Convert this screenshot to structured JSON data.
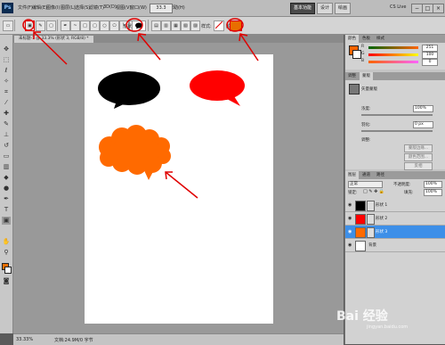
{
  "app": {
    "logo": "Ps",
    "menus": [
      "文件(F)",
      "编辑(E)",
      "图像(I)",
      "图层(L)",
      "选择(S)",
      "滤镜(T)",
      "3D(D)",
      "视图(V)",
      "窗口(W)",
      "帮助(H)"
    ],
    "zoom_label": "33.3",
    "workspaces": [
      "基本功能",
      "设计",
      "绘画"
    ],
    "cs_live": "CS Live",
    "window_controls": [
      "−",
      "□",
      "×"
    ]
  },
  "options_bar": {
    "style_label": "样式:",
    "color_label": "颜色:",
    "shape_label": "形状:",
    "color_value": "#e86e00"
  },
  "document": {
    "tab_label": "未标题-1 @ 33.3% (形状 3, RGB/8) *"
  },
  "shapes": [
    {
      "name": "black-speech-bubble",
      "color": "#000000"
    },
    {
      "name": "red-speech-bubble",
      "color": "#ff0000"
    },
    {
      "name": "orange-thought-bubble",
      "color": "#ff6a00"
    }
  ],
  "status": {
    "zoom": "33.33%",
    "doc": "文档:24.9M/0 字节"
  },
  "color_panel": {
    "tabs": [
      "颜色",
      "色板",
      "样式"
    ],
    "channels": [
      {
        "label": "R",
        "value": "251"
      },
      {
        "label": "G",
        "value": "100"
      },
      {
        "label": "B",
        "value": "0"
      }
    ]
  },
  "adjust_panel": {
    "tabs": [
      "调整",
      "蒙版"
    ],
    "title": "矢量蒙版",
    "density_label": "浓度:",
    "density_value": "100%",
    "feather_label": "羽化:",
    "feather_value": "0 px",
    "refine_label": "调整:",
    "buttons": [
      "蒙版边缘...",
      "颜色范围...",
      "反相"
    ]
  },
  "layers_panel": {
    "tabs": [
      "图层",
      "通道",
      "路径"
    ],
    "blend_mode": "正常",
    "opacity_label": "不透明度:",
    "opacity_value": "100%",
    "lock_label": "锁定:",
    "fill_label": "填充:",
    "fill_value": "100%",
    "layers": [
      {
        "name": "形状 1",
        "color": "#000000",
        "selected": false
      },
      {
        "name": "形状 2",
        "color": "#ff0000",
        "selected": false
      },
      {
        "name": "形状 3",
        "color": "#ff6a00",
        "selected": true
      },
      {
        "name": "背景",
        "color": "#ffffff",
        "selected": false
      }
    ]
  },
  "watermark": {
    "brand": "Bai 经验",
    "url": "jingyan.baidu.com"
  }
}
